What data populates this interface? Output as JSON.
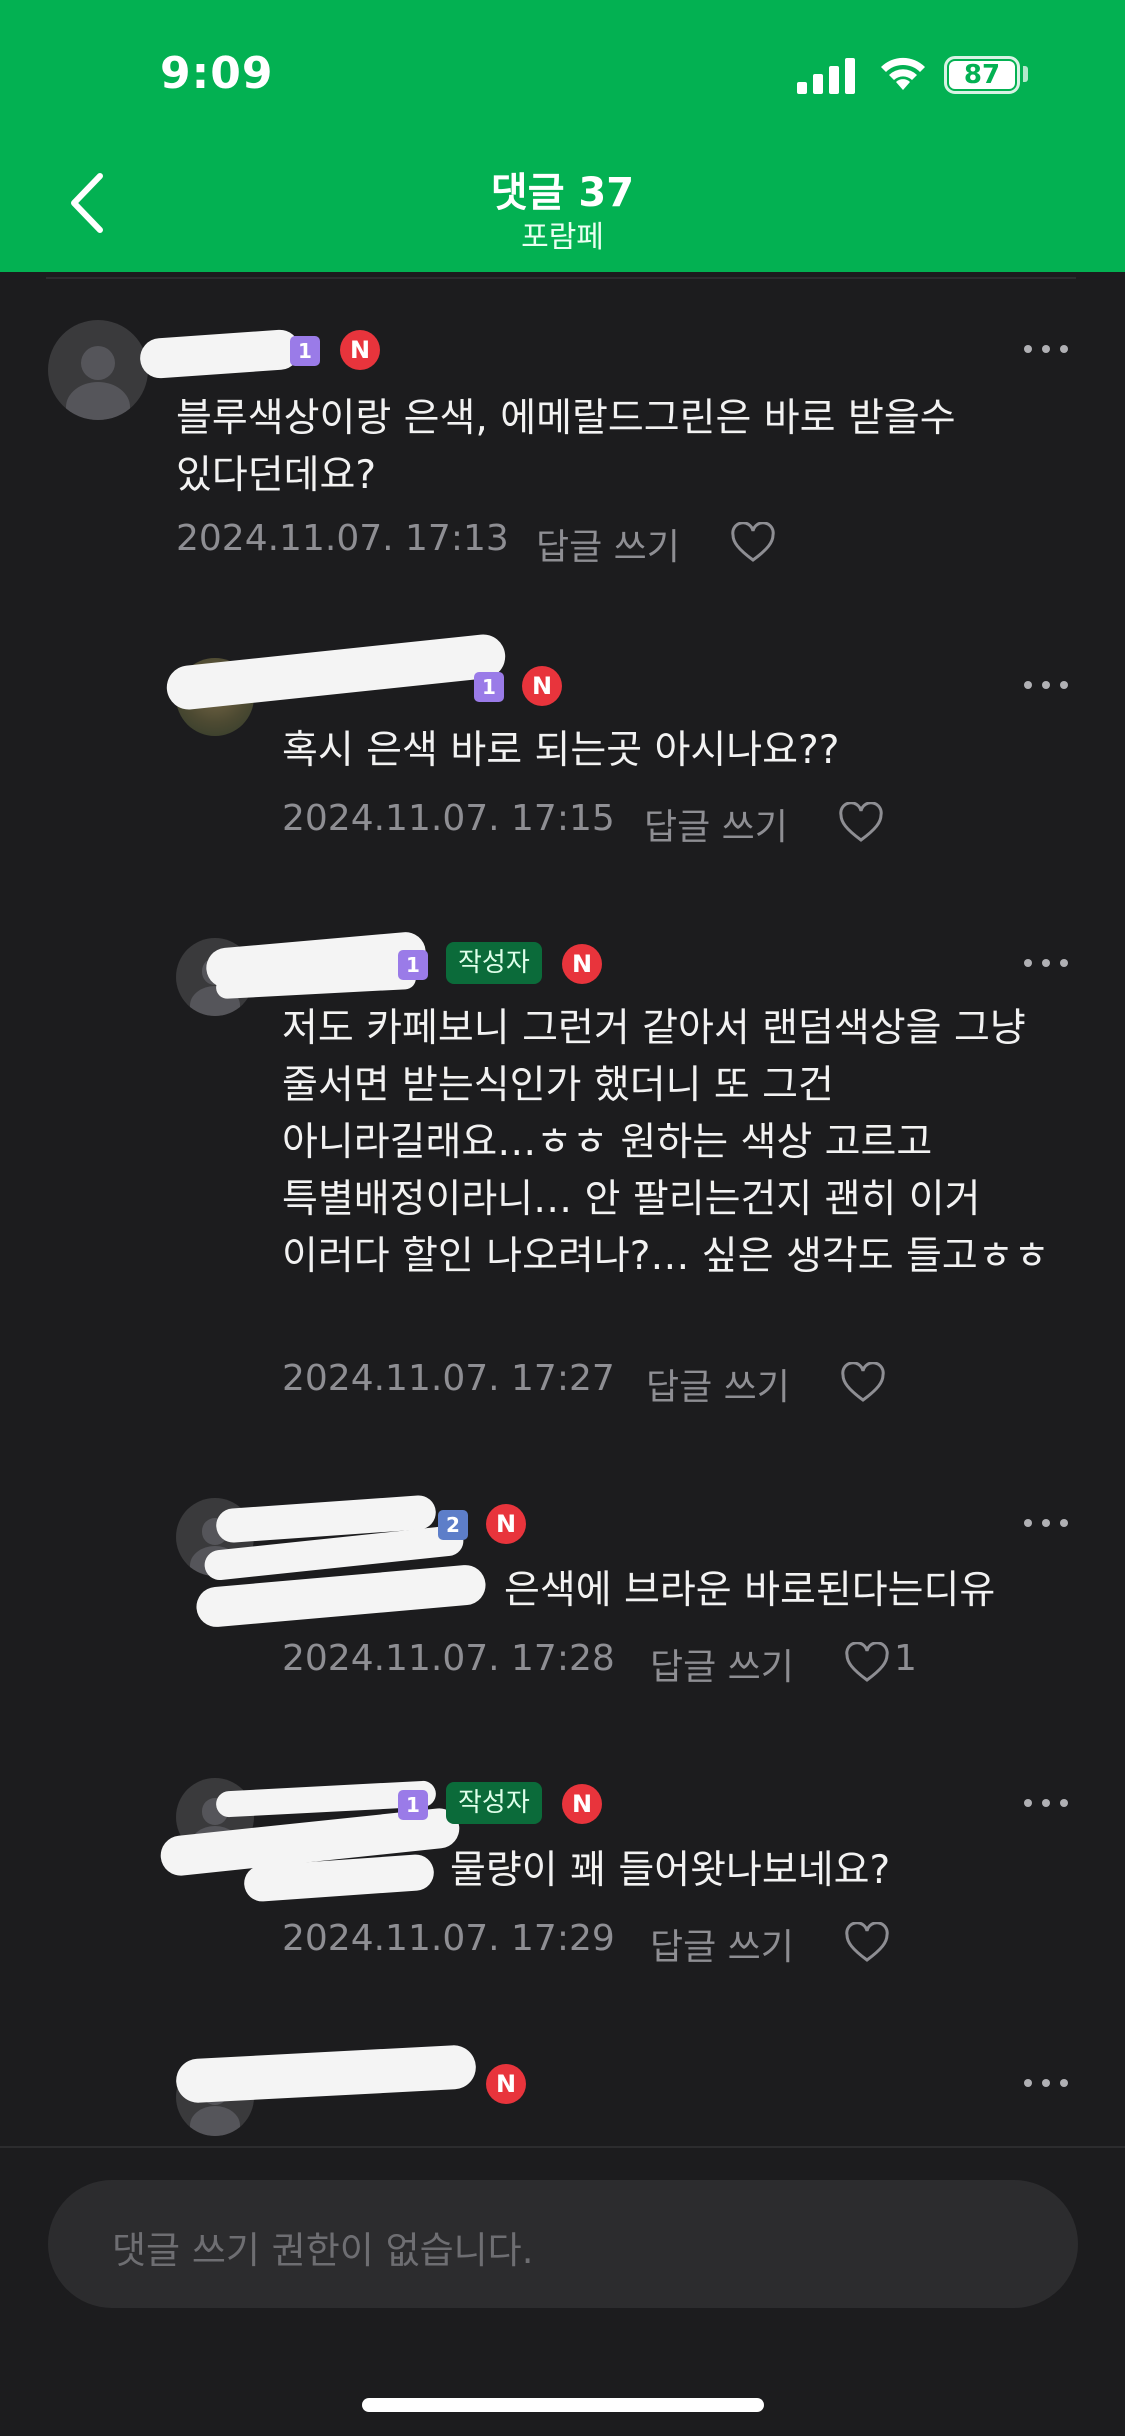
{
  "status_bar": {
    "time": "9:09",
    "battery": "87"
  },
  "header": {
    "title": "댓글 37",
    "subtitle": "포람페",
    "back_icon": "chevron-left-icon"
  },
  "comments": [
    {
      "nickname": "",
      "badges": [
        "1",
        "N"
      ],
      "text": "블루색상이랑 은색, 에메랄드그린은 바로 받을수 있다던데요?",
      "date": "2024.11.07. 17:13",
      "reply_label": "답글 쓰기",
      "likes": ""
    },
    {
      "nickname": "",
      "badges": [
        "1",
        "N"
      ],
      "text": "혹시 은색 바로 되는곳 아시나요??",
      "date": "2024.11.07. 17:15",
      "reply_label": "답글 쓰기",
      "likes": ""
    },
    {
      "nickname": "",
      "badges": [
        "1",
        "작성자",
        "N"
      ],
      "author_label": "작성자",
      "text": "저도 카페보니 그런거 같아서 랜덤색상을 그냥 줄서면 받는식인가 했더니 또 그건 아니라길래요…ㅎㅎ 원하는 색상 고르고 특별배정이라니… 안 팔리는건지 괜히 이거 이러다 할인 나오려나?… 싶은 생각도 들고ㅎㅎ",
      "date": "2024.11.07. 17:27",
      "reply_label": "답글 쓰기",
      "likes": ""
    },
    {
      "nickname": "",
      "badges": [
        "2",
        "N"
      ],
      "mention": "",
      "text": "은색에 브라운 바로된다는디유",
      "date": "2024.11.07. 17:28",
      "reply_label": "답글 쓰기",
      "likes": "1"
    },
    {
      "nickname": "",
      "badges": [
        "1",
        "작성자",
        "N"
      ],
      "author_label": "작성자",
      "mention": "",
      "text": "물량이 꽤 들어왓나보네요?",
      "date": "2024.11.07. 17:29",
      "reply_label": "답글 쓰기",
      "likes": ""
    },
    {
      "nickname": "",
      "badges": [
        "N"
      ],
      "mention": "",
      "text": "",
      "date": "",
      "reply_label": "",
      "likes": ""
    }
  ],
  "comment_input": {
    "placeholder": "댓글 쓰기 권한이 없습니다."
  },
  "colors": {
    "brand_green": "#03b152",
    "background": "#1c1c1e",
    "mention_blue": "#3a8af0",
    "badge_red": "#e8343c",
    "author_badge": "#0b6b3a"
  }
}
